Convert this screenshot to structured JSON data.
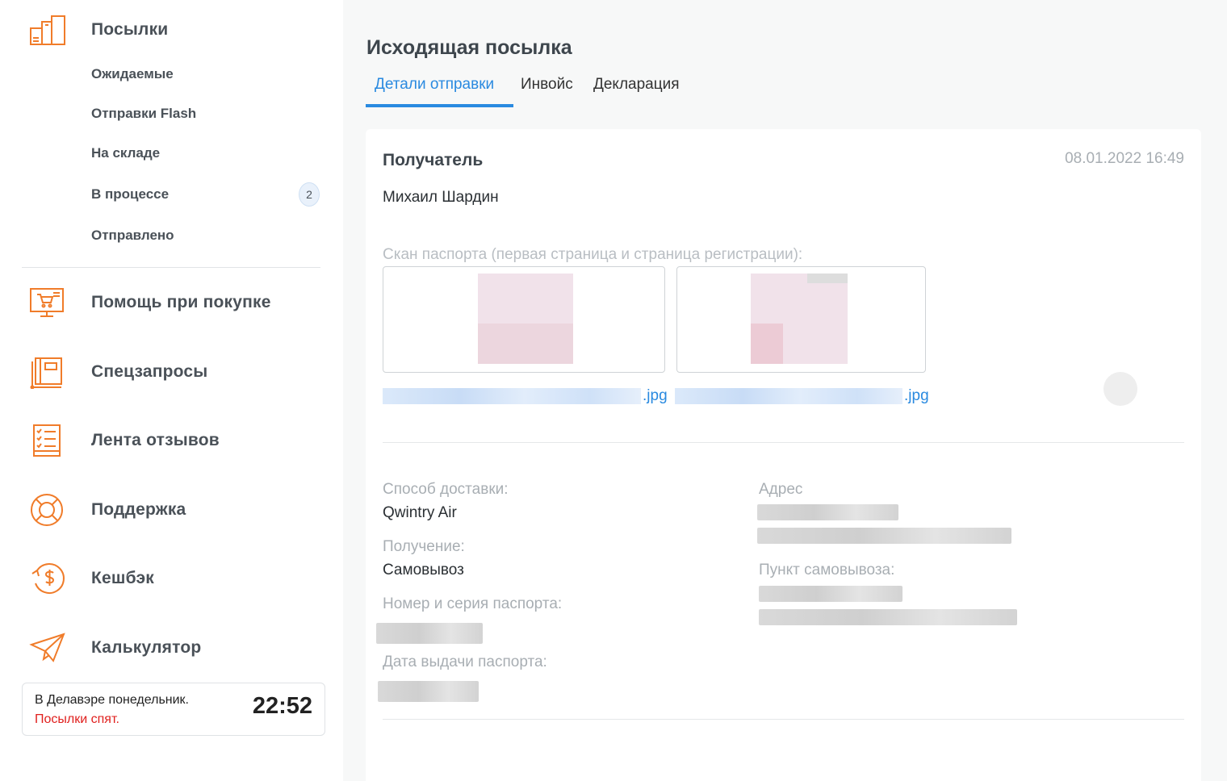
{
  "sidebar": {
    "parcels_label": "Посылки",
    "sub_items": [
      {
        "label": "Ожидаемые"
      },
      {
        "label": "Отправки Flash"
      },
      {
        "label": "На складе"
      },
      {
        "label": "В процессе",
        "badge": "2"
      },
      {
        "label": "Отправлено"
      }
    ],
    "main_items": [
      {
        "label": "Помощь при покупке",
        "icon": "monitor-cart-icon"
      },
      {
        "label": "Спецзапросы",
        "icon": "notebook-icon"
      },
      {
        "label": "Лента отзывов",
        "icon": "checklist-icon"
      },
      {
        "label": "Поддержка",
        "icon": "lifebuoy-icon"
      },
      {
        "label": "Кешбэк",
        "icon": "cashback-icon"
      },
      {
        "label": "Калькулятор",
        "icon": "paper-plane-icon"
      }
    ],
    "clock": {
      "line1": "В Делавэре понедельник.",
      "line2": "Посылки спят.",
      "time": "22:52"
    }
  },
  "main": {
    "title": "Исходящая посылка",
    "tabs": [
      {
        "label": "Детали отправки",
        "active": true
      },
      {
        "label": "Инвойс"
      },
      {
        "label": "Декларация"
      }
    ],
    "card": {
      "recipient_heading": "Получатель",
      "datetime": "08.01.2022 16:49",
      "recipient_name": "Михаил Шардин",
      "scan_label": "Скан паспорта (первая страница и страница регистрации):",
      "files": [
        {
          "ext": ".jpg"
        },
        {
          "ext": ".jpg"
        }
      ],
      "delivery_method_label": "Способ доставки:",
      "delivery_method_value": "Qwintry Air",
      "receipt_label": "Получение:",
      "receipt_value": "Самовывоз",
      "passport_number_label": "Номер и серия паспорта:",
      "passport_date_label": "Дата выдачи паспорта:",
      "address_label": "Адрес",
      "pickup_point_label": "Пункт самовывоза:"
    }
  },
  "colors": {
    "accent": "#2a8ae0",
    "icon_orange": "#f07c2a",
    "alert_red": "#e0201e"
  }
}
